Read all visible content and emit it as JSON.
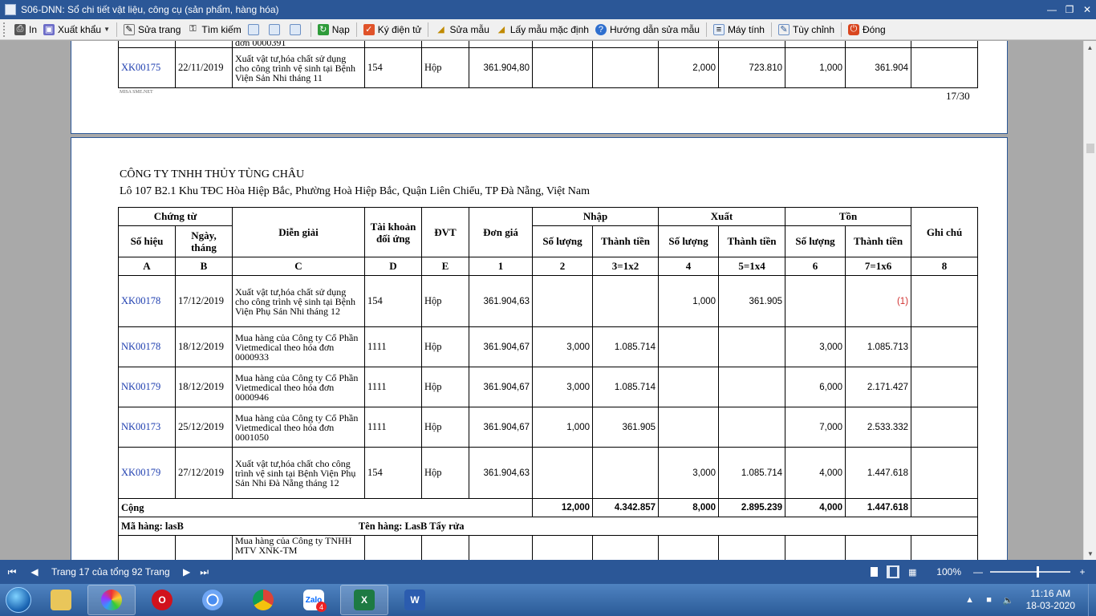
{
  "window": {
    "title": "S06-DNN: Sổ chi tiết vật liệu, công cụ (sản phẩm, hàng hóa)"
  },
  "toolbar": {
    "items": [
      {
        "label": "In",
        "icon": "printer-icon"
      },
      {
        "label": "Xuất khẩu",
        "icon": "save-icon"
      },
      {
        "label": "Sửa trang",
        "icon": "edit-page-icon"
      },
      {
        "label": "Tìm kiếm",
        "icon": "binoculars-icon"
      },
      {
        "label": "Nạp",
        "icon": "refresh-icon"
      },
      {
        "label": "Ký điện tử",
        "icon": "digital-sign-icon"
      },
      {
        "label": "Sửa mẫu",
        "icon": "edit-template-icon"
      },
      {
        "label": "Lấy mẫu mặc định",
        "icon": "default-template-icon"
      },
      {
        "label": "Hướng dẫn sửa mẫu",
        "icon": "help-icon"
      },
      {
        "label": "Máy tính",
        "icon": "calculator-icon"
      },
      {
        "label": "Tùy chỉnh",
        "icon": "customize-icon"
      },
      {
        "label": "Đóng",
        "icon": "close-icon"
      }
    ]
  },
  "page1": {
    "partial_text": "đơn 0000391",
    "row": {
      "doc": "XK00175",
      "date": "22/11/2019",
      "desc": "Xuất vật tư,hóa chất sử dụng cho công trình vệ sinh tại Bệnh Viện Sản Nhi tháng 11",
      "account": "154",
      "unit": "Hộp",
      "price": "361.904,80",
      "in_qty": "",
      "in_amt": "",
      "out_qty": "2,000",
      "out_amt": "723.810",
      "bal_qty": "1,000",
      "bal_amt": "361.904",
      "note": ""
    },
    "footer_left": "MISA SME.NET",
    "page_number": "17/30"
  },
  "page2": {
    "company": "CÔNG TY TNHH THỦY TÙNG CHÂU",
    "address": "Lô 107 B2.1 Khu TĐC Hòa Hiệp Bắc, Phường Hoà Hiệp Bắc, Quận Liên Chiểu, TP Đà Nẵng, Việt Nam",
    "headers": {
      "chung_tu": "Chứng từ",
      "so_hieu": "Số hiệu",
      "ngay_thang": "Ngày, tháng",
      "dien_giai": "Diễn giải",
      "tai_khoan": "Tài khoản đối ứng",
      "dvt": "ĐVT",
      "don_gia": "Đơn giá",
      "nhap": "Nhập",
      "xuat": "Xuất",
      "ton": "Tồn",
      "so_luong": "Số lượng",
      "thanh_tien": "Thành tiền",
      "ghi_chu": "Ghi chú"
    },
    "codes": [
      "A",
      "B",
      "C",
      "D",
      "E",
      "1",
      "2",
      "3=1x2",
      "4",
      "5=1x4",
      "6",
      "7=1x6",
      "8"
    ],
    "rows": [
      {
        "doc": "XK00178",
        "date": "17/12/2019",
        "desc": "Xuất vật tư,hóa chất sử dụng cho công trình vệ sinh tại Bệnh Viện Phụ Sản Nhi tháng 12",
        "account": "154",
        "unit": "Hộp",
        "price": "361.904,63",
        "in_qty": "",
        "in_amt": "",
        "out_qty": "1,000",
        "out_amt": "361.905",
        "bal_qty": "",
        "bal_amt": "(1)",
        "note": ""
      },
      {
        "doc": "NK00178",
        "date": "18/12/2019",
        "desc": "Mua hàng của Công ty Cổ Phần Vietmedical theo hóa đơn 0000933",
        "account": "1111",
        "unit": "Hộp",
        "price": "361.904,67",
        "in_qty": "3,000",
        "in_amt": "1.085.714",
        "out_qty": "",
        "out_amt": "",
        "bal_qty": "3,000",
        "bal_amt": "1.085.713",
        "note": ""
      },
      {
        "doc": "NK00179",
        "date": "18/12/2019",
        "desc": "Mua hàng của Công ty Cổ Phần Vietmedical theo hóa đơn 0000946",
        "account": "1111",
        "unit": "Hộp",
        "price": "361.904,67",
        "in_qty": "3,000",
        "in_amt": "1.085.714",
        "out_qty": "",
        "out_amt": "",
        "bal_qty": "6,000",
        "bal_amt": "2.171.427",
        "note": ""
      },
      {
        "doc": "NK00173",
        "date": "25/12/2019",
        "desc": "Mua hàng của Công ty Cổ Phần Vietmedical theo hóa đơn 0001050",
        "account": "1111",
        "unit": "Hộp",
        "price": "361.904,67",
        "in_qty": "1,000",
        "in_amt": "361.905",
        "out_qty": "",
        "out_amt": "",
        "bal_qty": "7,000",
        "bal_amt": "2.533.332",
        "note": ""
      },
      {
        "doc": "XK00179",
        "date": "27/12/2019",
        "desc": "Xuất vật tư,hóa chất cho công trình vệ sinh tại Bệnh Viện Phụ Sản Nhi Đà Nẵng tháng 12",
        "account": "154",
        "unit": "Hộp",
        "price": "361.904,63",
        "in_qty": "",
        "in_amt": "",
        "out_qty": "3,000",
        "out_amt": "1.085.714",
        "bal_qty": "4,000",
        "bal_amt": "1.447.618",
        "note": ""
      }
    ],
    "total": {
      "label": "Cộng",
      "in_qty": "12,000",
      "in_amt": "4.342.857",
      "out_qty": "8,000",
      "out_amt": "2.895.239",
      "bal_qty": "4,000",
      "bal_amt": "1.447.618"
    },
    "item_line": {
      "code_label": "Mã hàng:",
      "code": "lasB",
      "name_label": "Tên hàng:",
      "name": "LasB Tẩy rửa"
    },
    "next_row_desc": "Mua hàng của Công ty TNHH MTV XNK-TM"
  },
  "statusbar": {
    "page_text": "Trang 17 của tổng 92 Trang",
    "zoom": "100%"
  },
  "taskbar": {
    "apps": [
      {
        "name": "file-explorer",
        "icon": "folder-icon"
      },
      {
        "name": "picasa",
        "icon": "pinwheel-icon"
      },
      {
        "name": "opera",
        "icon": "opera-icon"
      },
      {
        "name": "chromium",
        "icon": "chromium-icon"
      },
      {
        "name": "chrome",
        "icon": "chrome-icon"
      },
      {
        "name": "zalo",
        "icon": "zalo-icon",
        "label": "Zalo",
        "badge": "4"
      },
      {
        "name": "excel",
        "icon": "excel-icon"
      },
      {
        "name": "word",
        "icon": "word-icon"
      }
    ],
    "time": "11:16 AM",
    "date": "18-03-2020"
  },
  "colors": {
    "titlebar": "#2b5797",
    "link": "#1f3fb0",
    "negative": "#d0302f"
  }
}
